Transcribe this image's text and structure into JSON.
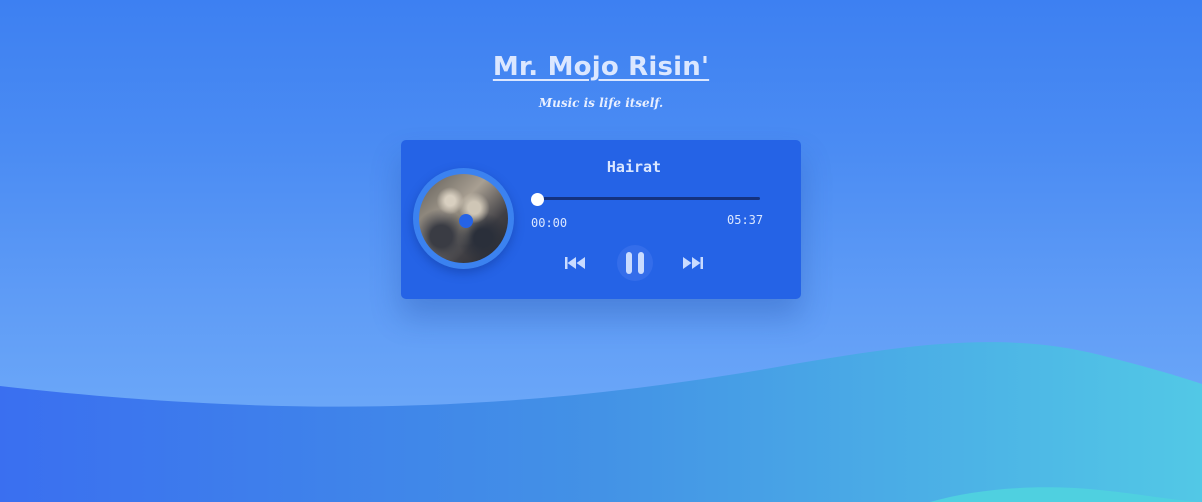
{
  "header": {
    "title": "Mr. Mojo Risin'",
    "tagline": "Music is life itself."
  },
  "player": {
    "track_title": "Hairat",
    "current_time": "00:00",
    "total_time": "05:37",
    "progress": 0,
    "state": "playing",
    "controls": {
      "prev_icon": "skip-back-icon",
      "play_pause_icon": "pause-icon",
      "next_icon": "skip-forward-icon"
    }
  },
  "colors": {
    "background_top": "#3d80f2",
    "card": "#2563e6",
    "text": "#dbe7ff",
    "wave_dark": "#3a6ff0",
    "wave_teal": "#4fc7e4"
  }
}
